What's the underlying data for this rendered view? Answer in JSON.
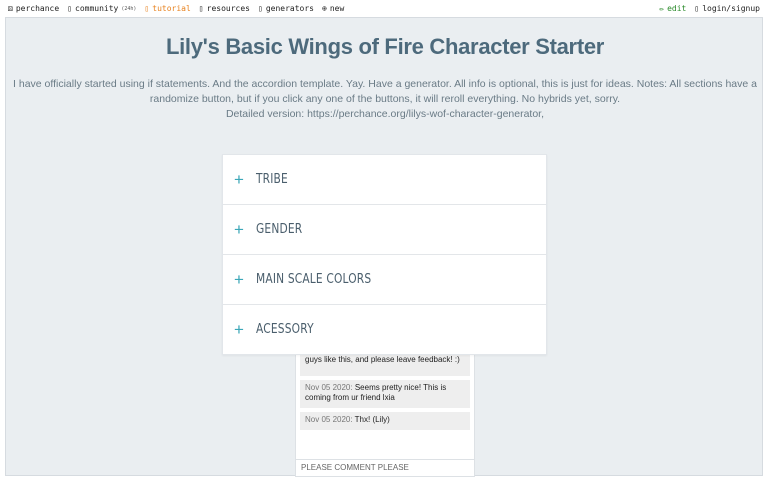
{
  "nav": {
    "brand": "perchance",
    "community": "community",
    "community_badge": "(24h)",
    "tutorial": "tutorial",
    "resources": "resources",
    "generators": "generators",
    "new": "new",
    "edit": "edit",
    "login": "login/signup"
  },
  "page": {
    "title": "Lily's Basic Wings of Fire Character Starter",
    "description_line1": "I have officially started using if statements. And the accordion template. Yay. Have a generator. All info is optional, this is just for ideas. Notes: All sections have a",
    "description_line2": "randomize button, but if you click any one of the buttons, it will reroll everything. No hybrids yet, sorry.",
    "description_line3": "Detailed version: https://perchance.org/lilys-wof-character-generator,"
  },
  "accordion": {
    "items": [
      {
        "label": "TRIBE"
      },
      {
        "label": "GENDER"
      },
      {
        "label": "MAIN SCALE COLORS"
      },
      {
        "label": "ACESSORY"
      }
    ]
  },
  "comments": {
    "items": [
      {
        "date": "",
        "text": "guys like this, and please leave feedback! :)"
      },
      {
        "date": "Nov 05 2020:",
        "text": "Seems pretty nice! This is coming from ur friend lxia"
      },
      {
        "date": "Nov 05 2020:",
        "text": "Thx! (Lily)"
      }
    ],
    "input_placeholder": "PLEASE COMMENT PLEASE"
  }
}
